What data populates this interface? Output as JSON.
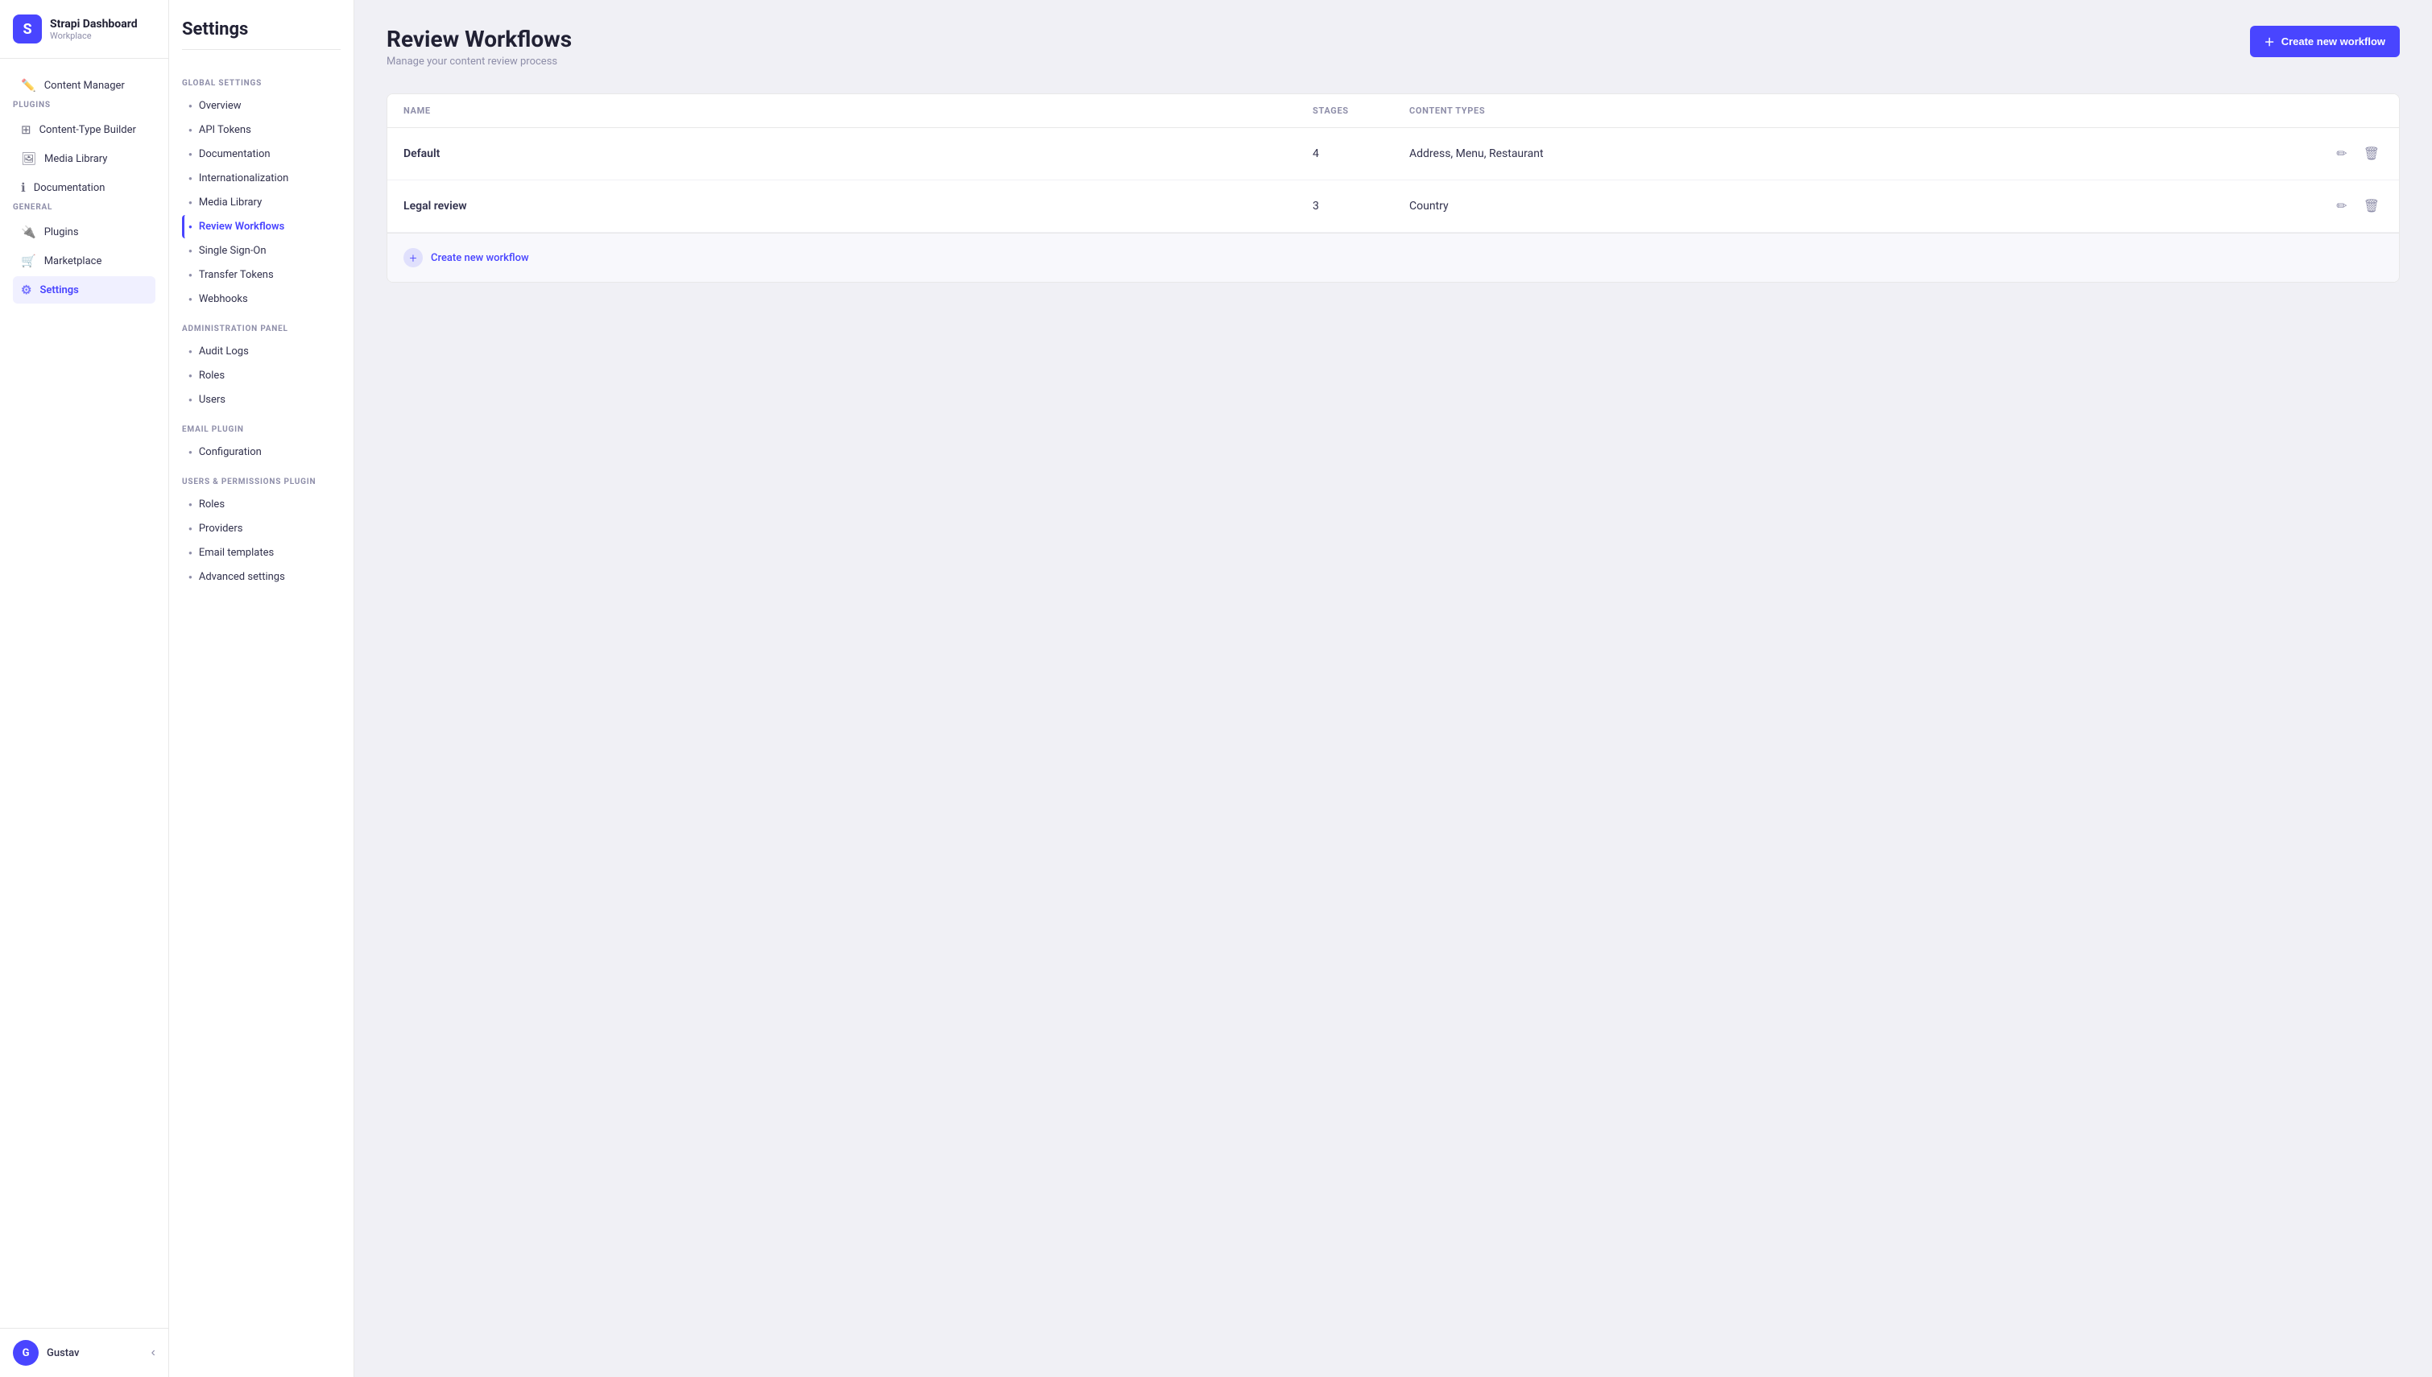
{
  "brand": {
    "title": "Strapi Dashboard",
    "subtitle": "Workplace",
    "icon": "S"
  },
  "nav": {
    "content_manager": "Content Manager",
    "plugins_label": "PLUGINS",
    "plugins": [
      {
        "label": "Content-Type Builder",
        "icon": "⊞"
      },
      {
        "label": "Media Library",
        "icon": "🖼"
      },
      {
        "label": "Documentation",
        "icon": "ℹ"
      }
    ],
    "general_label": "GENERAL",
    "general": [
      {
        "label": "Plugins",
        "icon": "🔌"
      },
      {
        "label": "Marketplace",
        "icon": "🛒"
      },
      {
        "label": "Settings",
        "icon": "⚙",
        "active": true
      }
    ]
  },
  "settings": {
    "title": "Settings",
    "global_section": "GLOBAL SETTINGS",
    "global_items": [
      {
        "label": "Overview"
      },
      {
        "label": "API Tokens"
      },
      {
        "label": "Documentation"
      },
      {
        "label": "Internationalization"
      },
      {
        "label": "Media Library"
      },
      {
        "label": "Review Workflows",
        "active": true
      },
      {
        "label": "Single Sign-On"
      },
      {
        "label": "Transfer Tokens"
      },
      {
        "label": "Webhooks"
      }
    ],
    "admin_section": "ADMINISTRATION PANEL",
    "admin_items": [
      {
        "label": "Audit Logs"
      },
      {
        "label": "Roles"
      },
      {
        "label": "Users"
      }
    ],
    "email_section": "EMAIL PLUGIN",
    "email_items": [
      {
        "label": "Configuration"
      }
    ],
    "users_section": "USERS & PERMISSIONS PLUGIN",
    "users_items": [
      {
        "label": "Roles"
      },
      {
        "label": "Providers"
      },
      {
        "label": "Email templates"
      },
      {
        "label": "Advanced settings"
      }
    ]
  },
  "page": {
    "title": "Review Workflows",
    "subtitle": "Manage your content review process",
    "create_btn": "Create new workflow"
  },
  "table": {
    "headers": {
      "name": "NAME",
      "stages": "STAGES",
      "content_types": "CONTENT TYPES"
    },
    "rows": [
      {
        "name": "Default",
        "stages": 4,
        "content_types": "Address, Menu, Restaurant"
      },
      {
        "name": "Legal review",
        "stages": 3,
        "content_types": "Country"
      }
    ],
    "create_row_label": "Create new workflow"
  },
  "user": {
    "initial": "G",
    "name": "Gustav"
  }
}
